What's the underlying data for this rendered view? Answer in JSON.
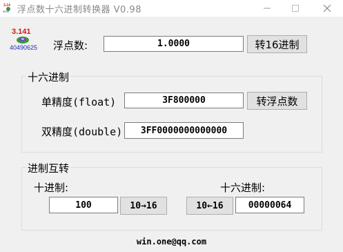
{
  "window": {
    "title": "浮点数十六进制转换器 V0.98",
    "icon": "float-hex-converter-icon"
  },
  "logo": {
    "top": "3.141",
    "bottom": "40490625"
  },
  "float_row": {
    "label": "浮点数:",
    "value": "1.0000",
    "button": "转16进制"
  },
  "hex_group": {
    "title": "十六进制",
    "single_label": "单精度(float)",
    "single_value": "3F800000",
    "to_float_button": "转浮点数",
    "double_label": "双精度(double)",
    "double_value": "3FF0000000000000"
  },
  "radix_group": {
    "title": "进制互转",
    "dec_label": "十进制:",
    "dec_value": "100",
    "dec_to_hex_button": "10→16",
    "hex_label": "十六进制:",
    "hex_to_dec_button": "10←16",
    "hex_value": "00000064"
  },
  "footer": {
    "email": "win.one@qq.com"
  }
}
